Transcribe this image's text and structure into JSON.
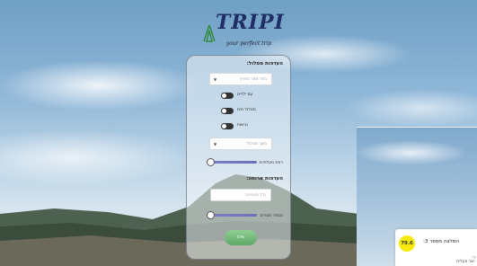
{
  "brand": {
    "name": "TRIPI",
    "tagline": "your perfect trip"
  },
  "form": {
    "route_prefs_title": "העדפות מסלול:",
    "region_select": {
      "value": "בחר אזור בארץ"
    },
    "toggles": [
      {
        "label": "עם ילדים",
        "checked": false
      },
      {
        "label": "מסלול מים",
        "checked": false
      },
      {
        "label": "נגישות",
        "checked": false
      }
    ],
    "duration_select": {
      "value": "משך מסלול"
    },
    "difficulty": {
      "label": "רמת מעלתיות",
      "value": 0
    },
    "accommodation_title": "העדפות ארוחה:",
    "budget_input": {
      "placeholder": "גדל משפחה"
    },
    "budget_slider": {
      "label": "מספר מטרים",
      "value": 0
    },
    "submit_label": "שלח"
  },
  "recommendation": {
    "score": "79.6",
    "title": "המלצה מספר 3:",
    "subtitle1": "אָר",
    "subtitle2": "ישר מעלית"
  },
  "colors": {
    "accent_slider": "#7d7fc4",
    "submit_green": "#5ea866",
    "score_yellow": "#f7e90a",
    "logo_navy": "#1f2f66"
  }
}
